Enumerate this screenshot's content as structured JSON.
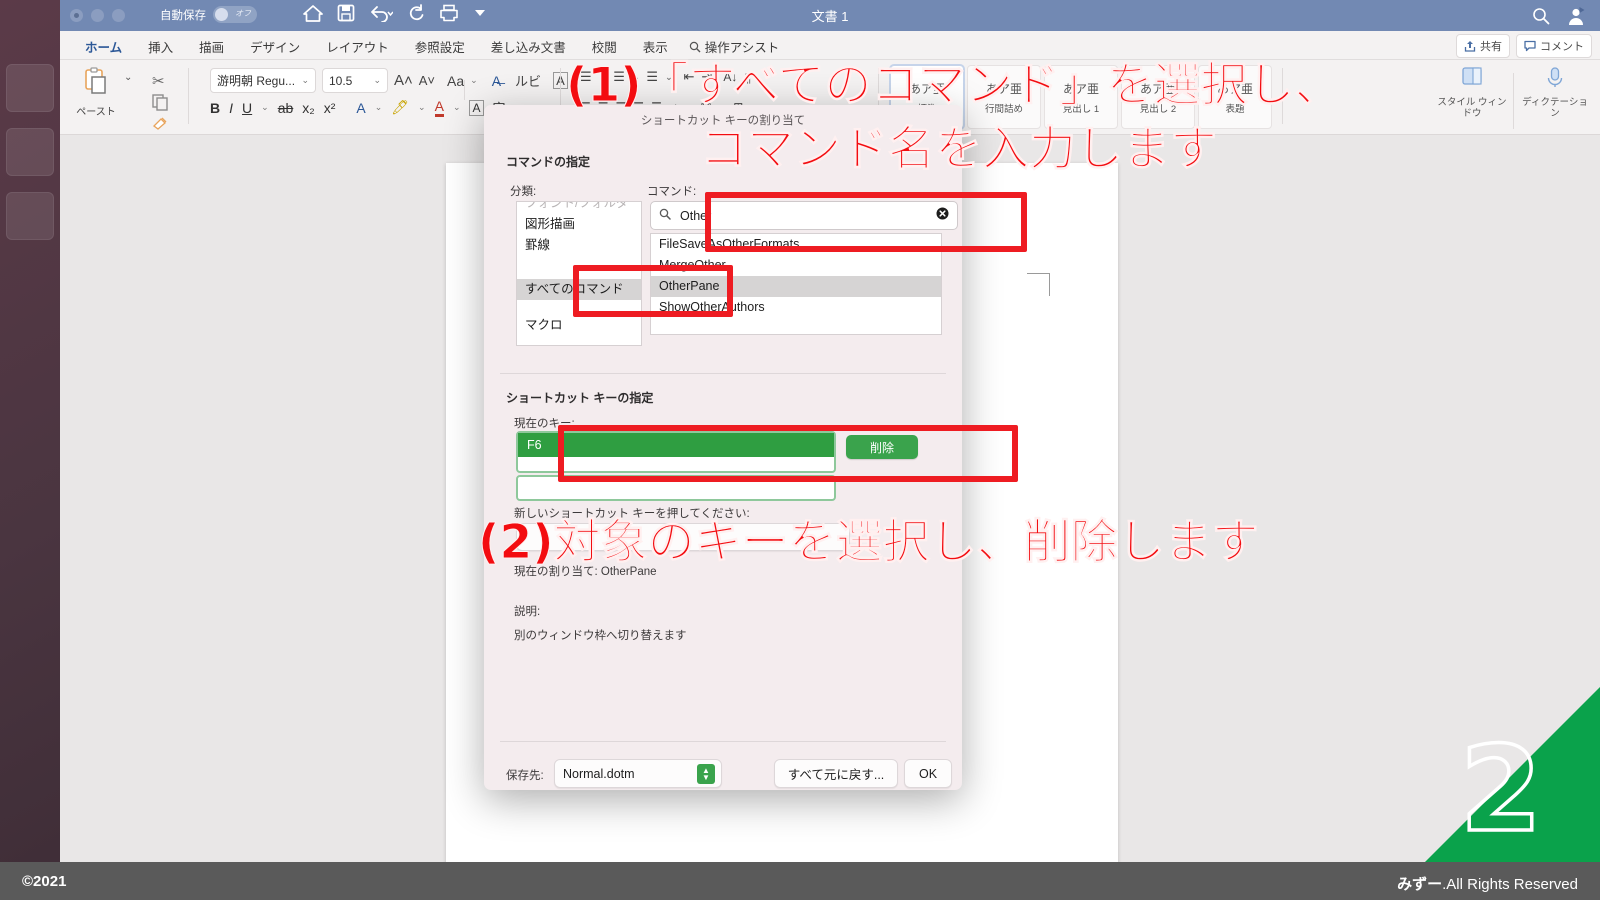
{
  "window": {
    "title": "文書 1",
    "autosave_label": "自動保存",
    "autosave_state": "オフ",
    "quick_access": [
      "home-icon",
      "save-icon",
      "undo-icon",
      "redo-icon",
      "print-icon",
      "customize-icon"
    ],
    "search_icon": "search-icon",
    "account_icon": "account-icon"
  },
  "ribbon": {
    "tabs": [
      {
        "label": "ホーム",
        "active": true
      },
      {
        "label": "挿入",
        "active": false
      },
      {
        "label": "描画",
        "active": false
      },
      {
        "label": "デザイン",
        "active": false
      },
      {
        "label": "レイアウト",
        "active": false
      },
      {
        "label": "参照設定",
        "active": false
      },
      {
        "label": "差し込み文書",
        "active": false
      },
      {
        "label": "校閲",
        "active": false
      },
      {
        "label": "表示",
        "active": false
      }
    ],
    "tell_me": "操作アシスト",
    "share_label": "共有",
    "comment_label": "コメント",
    "paste_label": "ペースト",
    "font_name": "游明朝 Regu...",
    "font_size": "10.5",
    "styles": [
      {
        "preview": "あア亜",
        "name": "標準"
      },
      {
        "preview": "あア亜",
        "name": "行間詰め"
      },
      {
        "preview": "あア亜",
        "name": "見出し 1"
      },
      {
        "preview": "あア亜",
        "name": "見出し 2"
      },
      {
        "preview": "あア亜",
        "name": "表題"
      }
    ],
    "style_pane_label": "スタイル ウィンドウ",
    "dictate_label": "ディクテーション"
  },
  "dialog": {
    "title": "ショートカット キーの割り当て",
    "section_command": "コマンドの指定",
    "label_category": "分類:",
    "label_command": "コマンド:",
    "categories": [
      {
        "label": "フォント/フォルダ",
        "selected": false,
        "clipped": true
      },
      {
        "label": "図形描画",
        "selected": false
      },
      {
        "label": "罫線",
        "selected": false
      },
      {
        "label": "すべてのコマンド",
        "selected": true
      },
      {
        "label": "マクロ",
        "selected": false
      }
    ],
    "search_value": "Other",
    "search_icon": "search-icon",
    "clear_icon": "clear-icon",
    "commands": [
      {
        "label": "FileSaveAsOtherFormats",
        "selected": false
      },
      {
        "label": "MergeOther",
        "selected": false
      },
      {
        "label": "OtherPane",
        "selected": true
      },
      {
        "label": "ShowOtherAuthors",
        "selected": false
      }
    ],
    "section_shortcut": "ショートカット キーの指定",
    "label_current_keys": "現在のキー:",
    "current_key_selected": "F6",
    "delete_button": "削除",
    "label_press_new_key": "新しいショートカット キーを押してください:",
    "new_key_value": "",
    "label_currently_assigned": "現在の割り当て: OtherPane",
    "label_description": "説明:",
    "description_text": "別のウィンドウ枠へ切り替えます",
    "label_save_in": "保存先:",
    "save_in_value": "Normal.dotm",
    "reset_all_button": "すべて元に戻す...",
    "ok_button": "OK"
  },
  "annotations": {
    "step1_line1": "(1)「すべてのコマンド」を選択し、",
    "step1_line2": "コマンド名を入力します",
    "step2": "(2)対象のキーを選択し、削除します",
    "accent_color": "#ee1c22"
  },
  "corner": {
    "number": "2",
    "color": "#0aa24b"
  },
  "footer": {
    "copyright": "©2021",
    "owner": "みずー",
    "rights": ".All Rights Reserved"
  }
}
